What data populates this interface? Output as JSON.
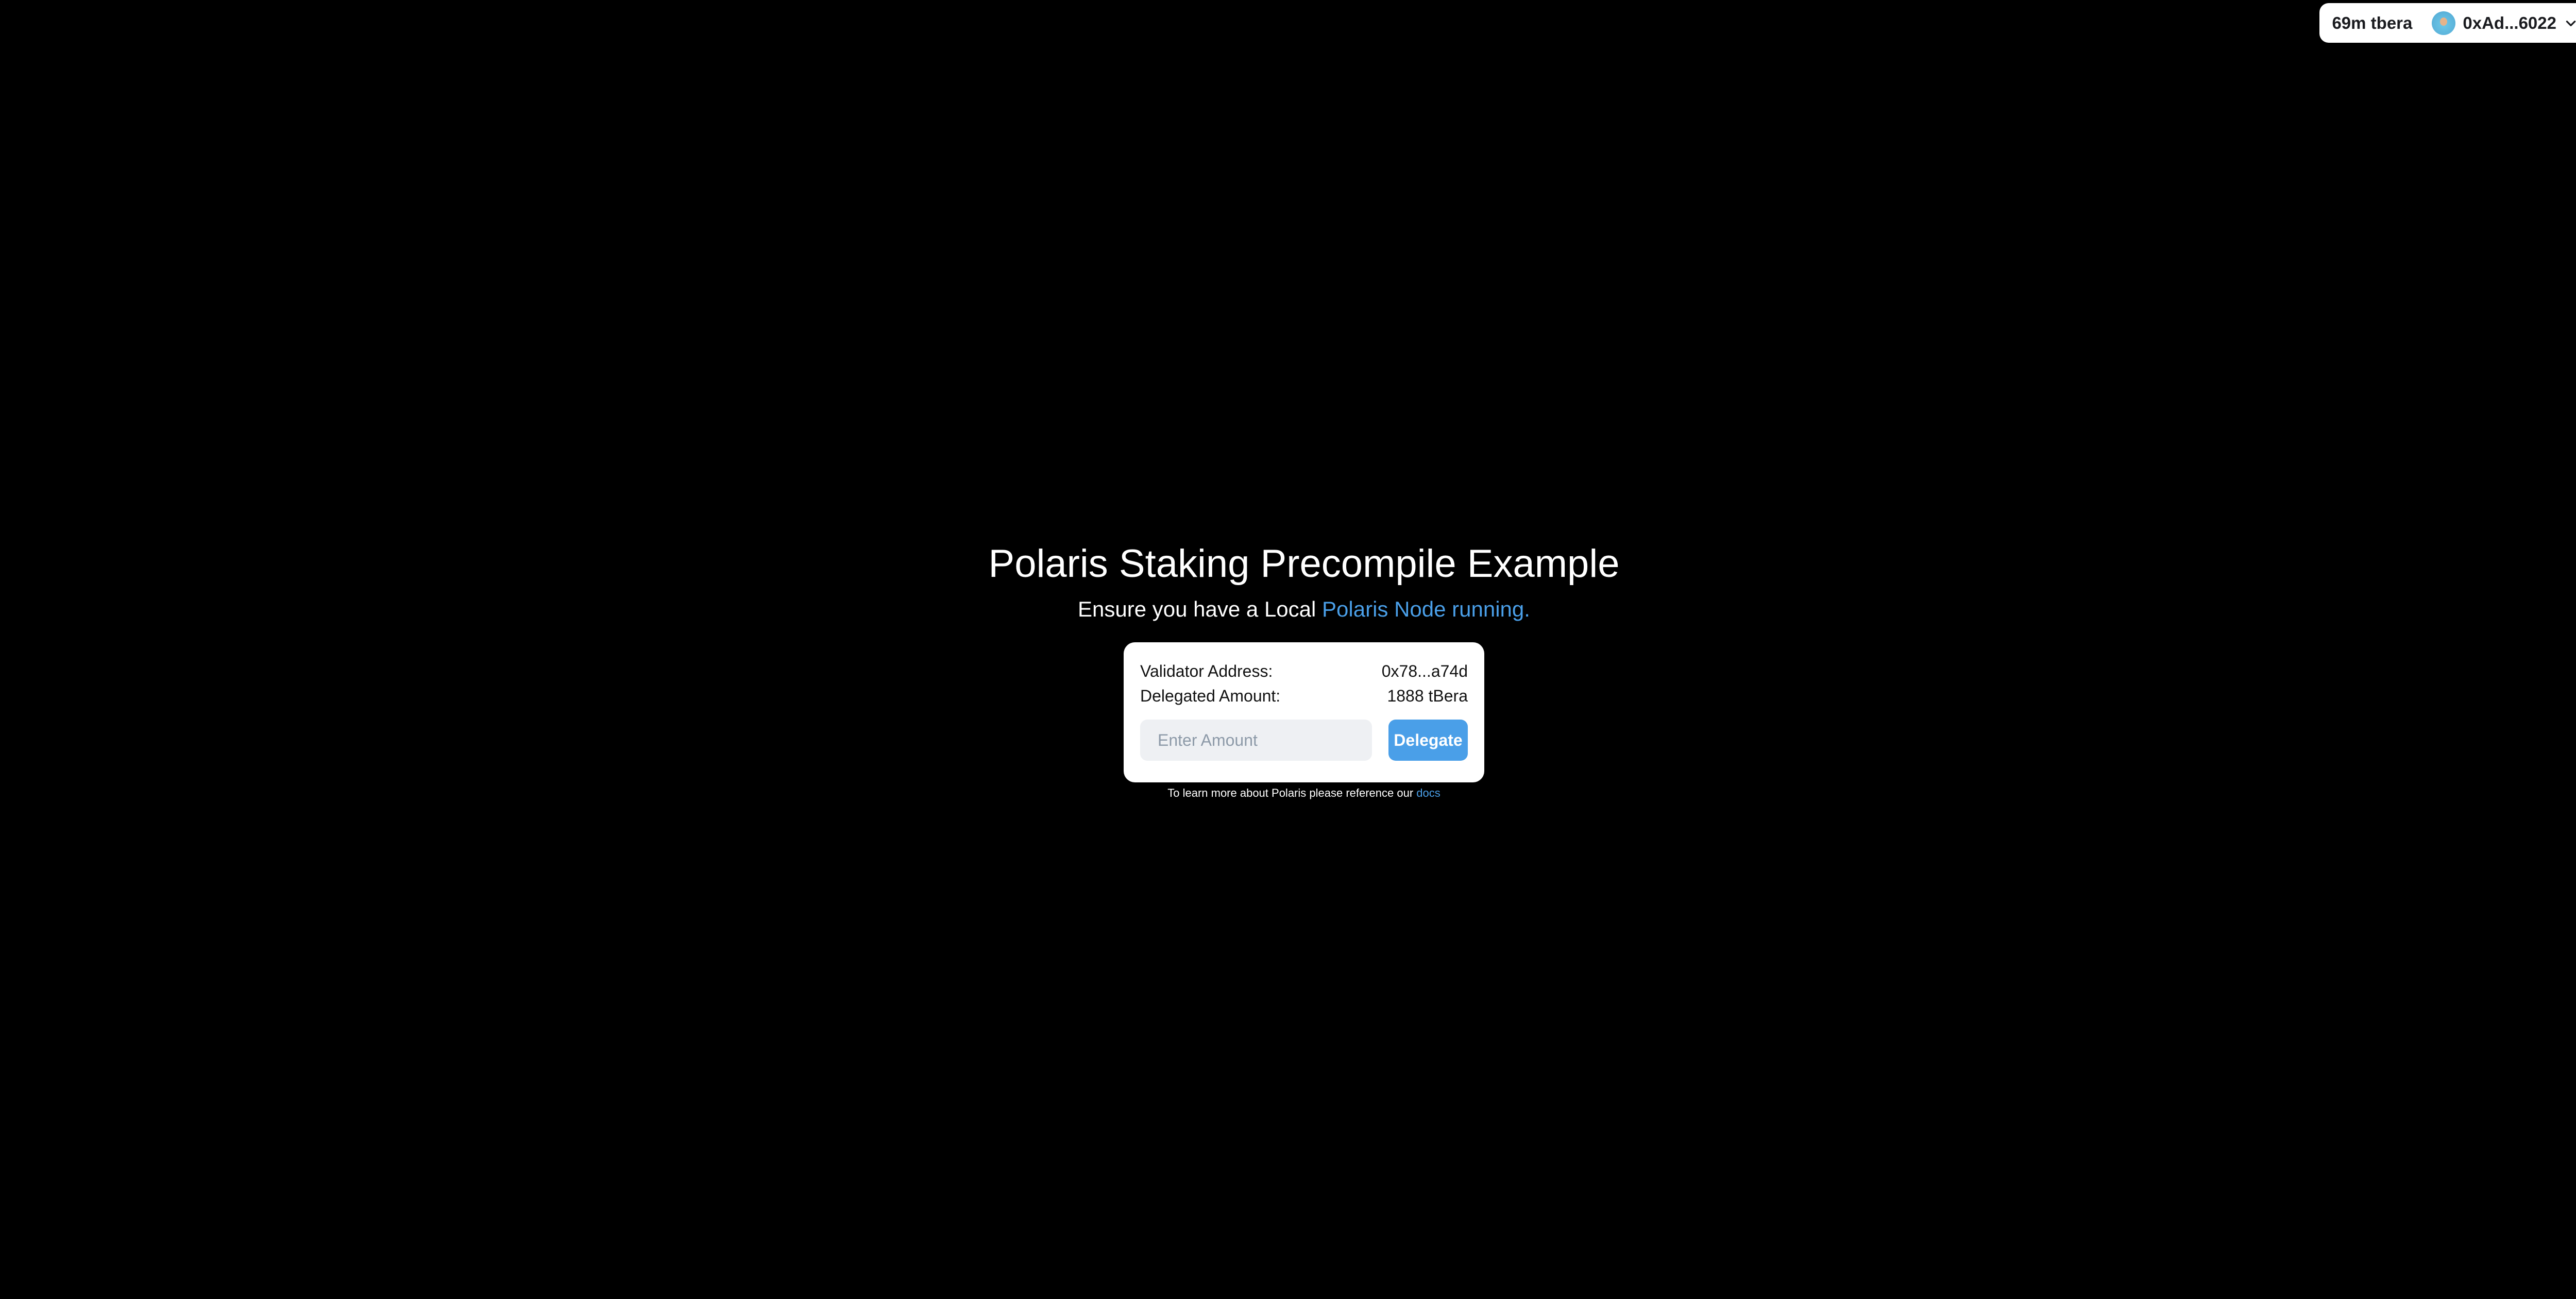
{
  "wallet": {
    "balance": "69m tbera",
    "account": "0xAd...6022",
    "avatar_icon": "avatar-icon",
    "chevron_icon": "chevron-down-icon"
  },
  "main": {
    "title": "Polaris Staking Precompile Example",
    "subtitle_prefix": "Ensure you have a Local ",
    "subtitle_link": "Polaris Node running.",
    "card": {
      "validator_label": "Validator Address:",
      "validator_value": "0x78...a74d",
      "delegated_label": "Delegated Amount:",
      "delegated_value": "1888 tBera",
      "amount_placeholder": "Enter Amount",
      "amount_value": "",
      "delegate_button": "Delegate"
    },
    "footer_text": "To learn more about Polaris please reference our ",
    "footer_link": "docs"
  },
  "colors": {
    "background": "#000000",
    "accent": "#4a9fe8",
    "card": "#ffffff",
    "input_bg": "#eef0f3"
  }
}
